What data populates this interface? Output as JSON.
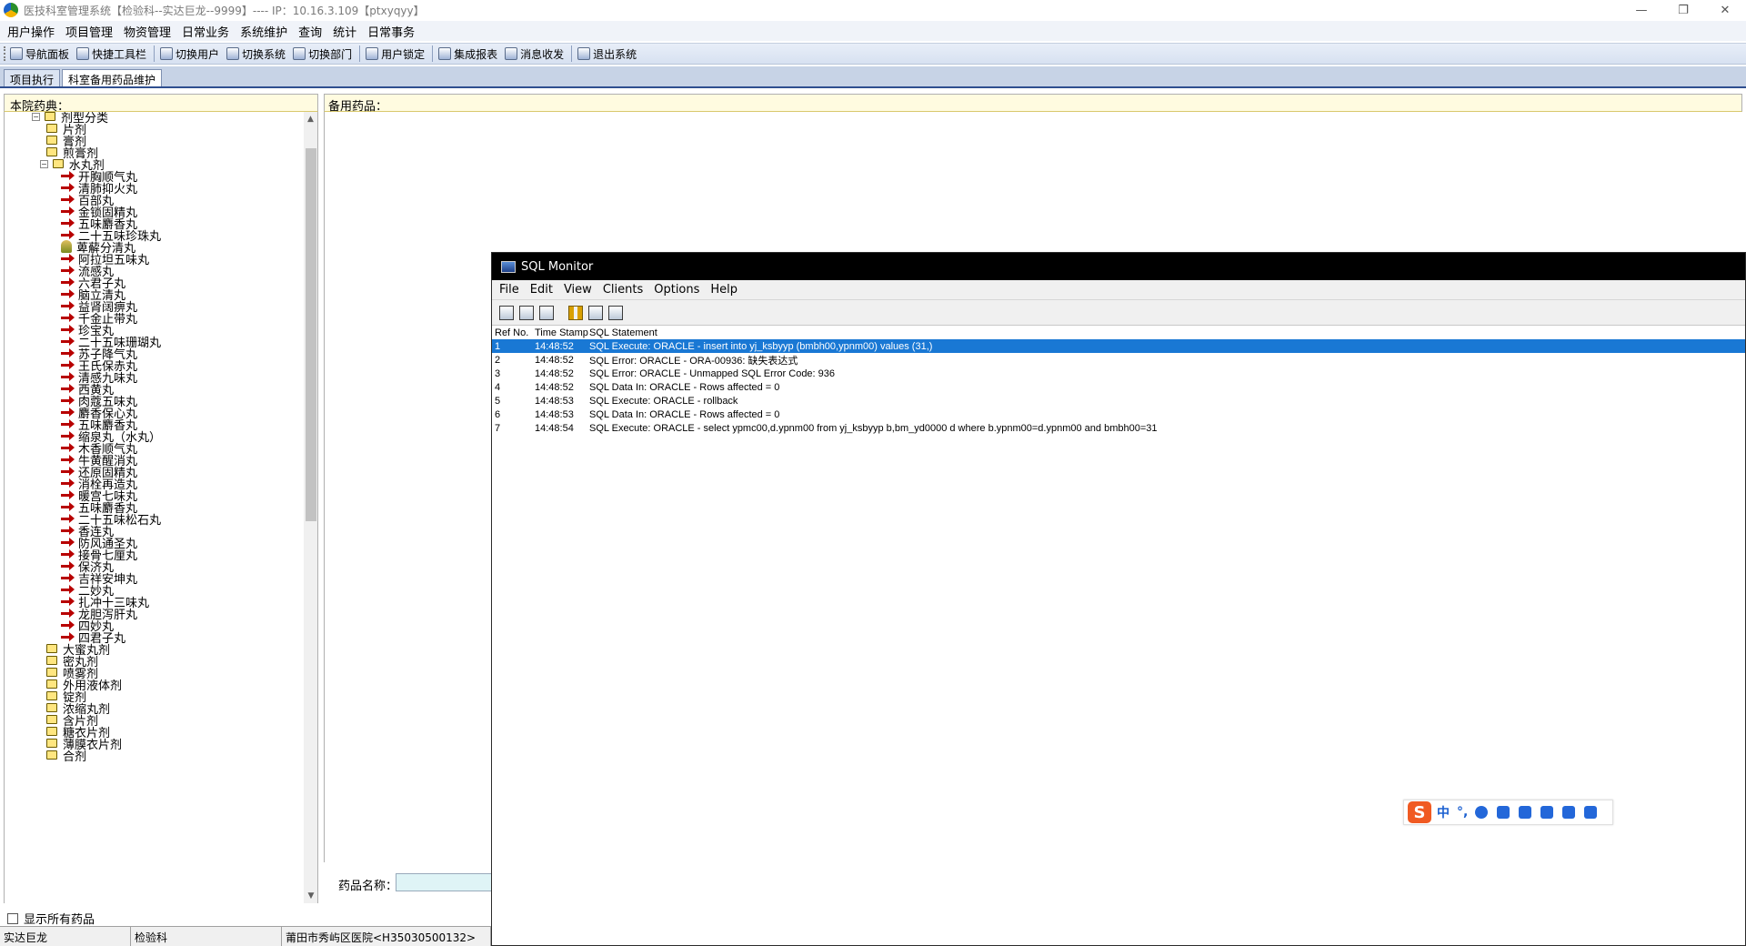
{
  "window": {
    "title": "医技科室管理系统【检验科--实达巨龙--9999】---- IP：10.16.3.109【ptxyqyy】",
    "controls": [
      "—",
      "❐",
      "✕"
    ]
  },
  "menubar": [
    "用户操作",
    "项目管理",
    "物资管理",
    "日常业务",
    "系统维护",
    "查询",
    "统计",
    "日常事务"
  ],
  "toolbar": [
    "导航面板",
    "快捷工具栏",
    "切换用户",
    "切换系统",
    "切换部门",
    "用户锁定",
    "集成报表",
    "消息收发",
    "退出系统"
  ],
  "tabs": [
    "项目执行",
    "科室备用药品维护"
  ],
  "left_panel": {
    "header": "本院药典：",
    "tree": {
      "root": "剂型分类",
      "top_folders_before": [
        "片剂",
        "膏剂",
        "煎膏剂"
      ],
      "expanded_folder": "水丸剂",
      "items": [
        "开胸顺气丸",
        "清肺抑火丸",
        "百部丸",
        "金锁固精丸",
        "五味麝香丸",
        "二十五味珍珠丸",
        "萆薢分清丸",
        "阿拉坦五味丸",
        "流感丸",
        "六君子丸",
        "脑立清丸",
        "益肾阔痹丸",
        "千金止带丸",
        "珍宝丸",
        "二十五味珊瑚丸",
        "苏子降气丸",
        "王氏保赤丸",
        "清感九味丸",
        "西黄丸",
        "肉蔻五味丸",
        "麝香保心丸",
        "五味麝香丸",
        "缩泉丸（水丸）",
        "木香顺气丸",
        "牛黄醒消丸",
        "还原固精丸",
        "消栓再造丸",
        "暖宫七味丸",
        "五味麝香丸",
        "二十五味松石丸",
        "香连丸",
        "防风通圣丸",
        "接骨七厘丸",
        "保济丸",
        "吉祥安坤丸",
        "二妙丸",
        "扎冲十三味丸",
        "龙胆泻肝丸",
        "四妙丸",
        "四君子丸"
      ],
      "top_folders_after": [
        "大蜜丸剂",
        "密丸剂",
        "喷雾剂",
        "外用液体剂",
        "锭剂",
        "浓缩丸剂",
        "含片剂",
        "糖衣片剂",
        "薄膜衣片剂",
        "合剂"
      ]
    },
    "show_all_label": "显示所有药品"
  },
  "right_panel": {
    "header": "备用药品：",
    "name_label": "药品名称："
  },
  "statusbar": [
    "实达巨龙",
    "检验科",
    "莆田市秀屿区医院<H35030500132>"
  ],
  "sql_monitor": {
    "title": "SQL Monitor",
    "menu": [
      "File",
      "Edit",
      "View",
      "Clients",
      "Options",
      "Help"
    ],
    "columns": [
      "Ref No.",
      "Time Stamp",
      "SQL Statement"
    ],
    "rows": [
      {
        "ref": "1",
        "ts": "14:48:52",
        "sql": "SQL Execute: ORACLE - insert into yj_ksbyyp (bmbh00,ypnm00) values (31,)"
      },
      {
        "ref": "2",
        "ts": "14:48:52",
        "sql": "SQL Error: ORACLE - ORA-00936: 缺失表达式"
      },
      {
        "ref": "3",
        "ts": "14:48:52",
        "sql": "SQL Error: ORACLE - Unmapped SQL Error Code: 936"
      },
      {
        "ref": "4",
        "ts": "14:48:52",
        "sql": "SQL Data In: ORACLE - Rows affected = 0"
      },
      {
        "ref": "5",
        "ts": "14:48:53",
        "sql": "SQL Execute: ORACLE - rollback"
      },
      {
        "ref": "6",
        "ts": "14:48:53",
        "sql": "SQL Data In: ORACLE - Rows affected = 0"
      },
      {
        "ref": "7",
        "ts": "14:48:54",
        "sql": "SQL Execute: ORACLE - select ypmc00,d.ypnm00 from yj_ksbyyp b,bm_yd0000 d where b.ypnm00=d.ypnm00 and bmbh00=31"
      }
    ],
    "selected_row": 0
  },
  "ime": {
    "logo": "S",
    "mode": "中",
    "punct": "°,"
  }
}
